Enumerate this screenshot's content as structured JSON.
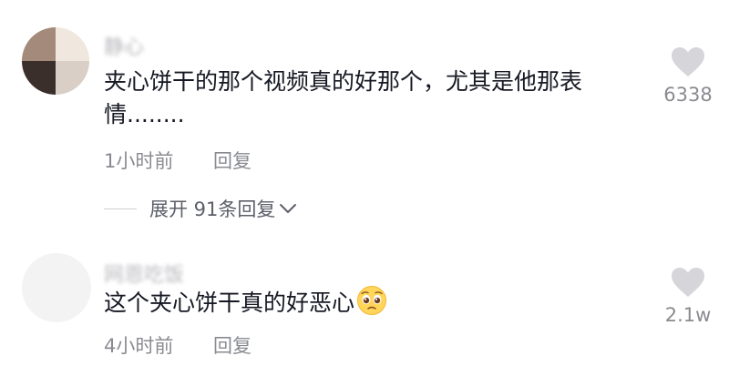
{
  "comments": [
    {
      "username": "静心",
      "text": "夹心饼干的那个视频真的好那个，尤其是他那表情........",
      "time": "1小时前",
      "reply_label": "回复",
      "likes": "6338",
      "expand_label": "展开 91条回复"
    },
    {
      "username": "网恩吃饭",
      "text": "这个夹心饼干真的好恶心",
      "emoji": "pleading-face",
      "time": "4小时前",
      "reply_label": "回复",
      "likes": "2.1w"
    }
  ],
  "colors": {
    "text": "#161823",
    "meta": "#8a8b91",
    "icon": "#d6d6da"
  }
}
